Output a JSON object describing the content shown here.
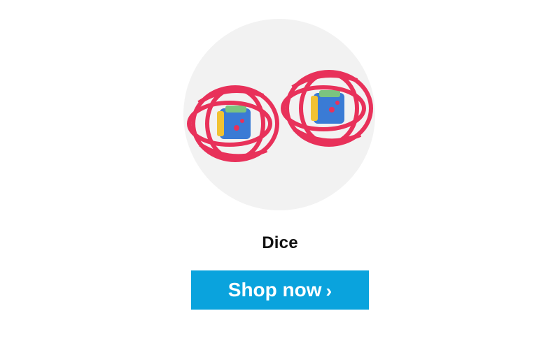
{
  "product": {
    "title": "Dice",
    "image_icon": "cage-dice-toy-icon",
    "colors": {
      "circle_bg": "#f2f2f2",
      "cage": "#e8315a",
      "dice_blue": "#3a7bd5",
      "dice_yellow": "#f1c232",
      "dice_green": "#7bc47f"
    }
  },
  "cta": {
    "label": "Shop now",
    "chevron": "›",
    "icon": "chevron-right-icon",
    "bg_color": "#0aa3dd",
    "text_color": "#ffffff"
  }
}
